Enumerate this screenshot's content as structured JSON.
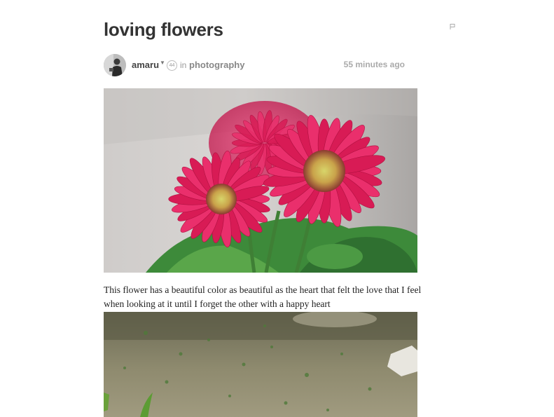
{
  "post": {
    "title": "loving flowers",
    "author": "amaru",
    "reputation": "44",
    "in_label": "in",
    "category": "photography",
    "timestamp": "55 minutes ago",
    "body": "This flower has a beautiful color as beautiful as the heart that felt the love that I feel when looking at it until I forget the other with a happy heart"
  },
  "icons": {
    "flag": "flag-icon",
    "caret": "caret-down-icon"
  },
  "colors": {
    "title": "#333333",
    "meta": "#999999",
    "flower": "#e0245e"
  }
}
